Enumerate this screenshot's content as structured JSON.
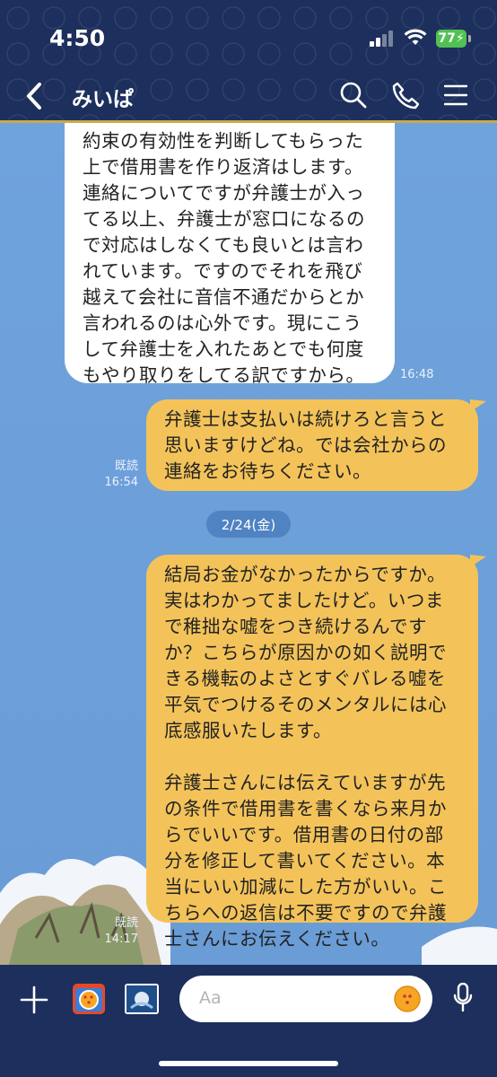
{
  "status": {
    "time": "4:50",
    "battery": "77"
  },
  "header": {
    "title": "みいぱ"
  },
  "messages": [
    {
      "side": "left",
      "text": "約束の有効性を判断してもらった\n上で借用書を作り返済はします。\n連絡についてですが弁護士が入っ\nてる以上、弁護士が窓口になるの\nで対応はしなくても良いとは言わ\nれています。ですのでそれを飛び\n越えて会社に音信不通だからとか\n言われるのは心外です。現にこう\nして弁護士を入れたあとでも何度\nもやり取りをしてる訳ですから。",
      "time": "16:48"
    },
    {
      "side": "right",
      "text": "弁護士は支払いは続けろと言うと\n思いますけどね。では会社からの\n連絡をお待ちください。",
      "read": "既読",
      "time": "16:54"
    },
    {
      "side": "right",
      "text": "結局お金がなかったからですか。\n実はわかってましたけど。いつま\nで稚拙な嘘をつき続けるんです\nか？こちらが原因かの如く説明で\nきる機転のよさとすぐバレる嘘を\n平気でつけるそのメンタルには心\n底感服いたします。\n\n弁護士さんには伝えていますが先\nの条件で借用書を書くなら来月か\nらでいいです。借用書の日付の部\n分を修正して書いてください。本\n当にいい加減にした方がいい。こ\nちらへの返信は不要ですので弁護\n士さんにお伝えください。",
      "read": "既読",
      "time": "14:17"
    }
  ],
  "date_separator": "2/24(金)",
  "input": {
    "placeholder": "Aa"
  },
  "colors": {
    "header": "#1d2f5c",
    "accent": "#c9a94a",
    "my_bubble": "#f3c35a",
    "chat_bg": "#6d9fd8"
  }
}
